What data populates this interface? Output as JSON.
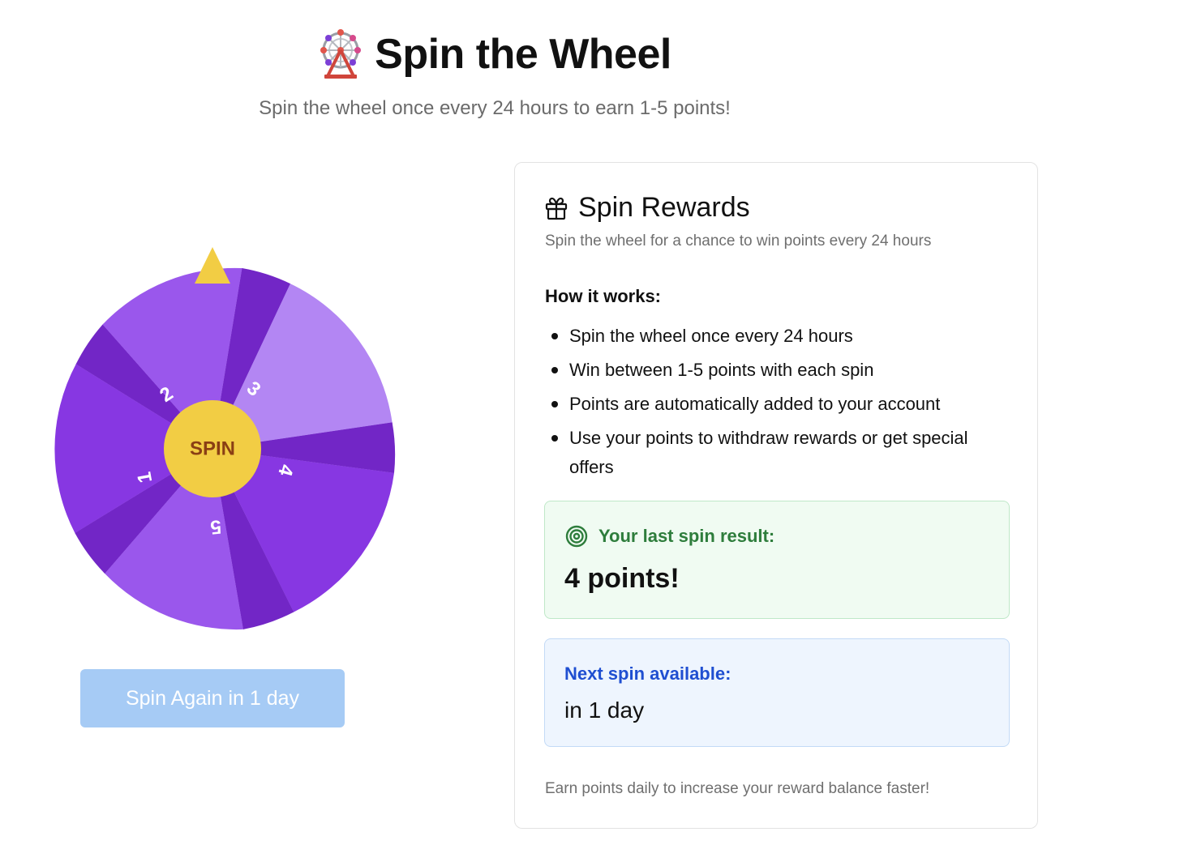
{
  "header": {
    "title": "Spin the Wheel",
    "subtitle": "Spin the wheel once every 24 hours to earn 1-5 points!"
  },
  "wheel": {
    "center_label": "SPIN",
    "segment_labels": [
      "1",
      "2",
      "3",
      "4",
      "5"
    ],
    "colors": {
      "pointer": "#f2cd44",
      "hub": "#f2cd44",
      "hub_text": "#8a3f14",
      "segment_light": "#b386f3",
      "segment_medium": "#9a57ec",
      "segment_main": "#8737e2",
      "segment_dark": "#7226c6"
    }
  },
  "spin_button": {
    "label": "Spin Again in 1 day",
    "disabled": true
  },
  "rewards_card": {
    "title": "Spin Rewards",
    "description": "Spin the wheel for a chance to win points every 24 hours",
    "how_title": "How it works:",
    "how_items": [
      "Spin the wheel once every 24 hours",
      "Win between 1-5 points with each spin",
      "Points are automatically added to your account",
      "Use your points to withdraw rewards or get special offers"
    ],
    "last_result": {
      "label": "Your last spin result:",
      "value": "4 points!"
    },
    "next_spin": {
      "label": "Next spin available:",
      "value": "in 1 day"
    },
    "footer": "Earn points daily to increase your reward balance faster!"
  }
}
